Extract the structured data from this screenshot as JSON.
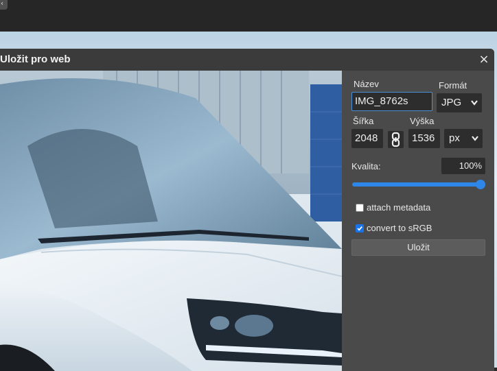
{
  "dialog": {
    "title": "Uložit pro web",
    "close_glyph": "×"
  },
  "panel": {
    "name_label": "Název",
    "name_value": "IMG_8762s",
    "format_label": "Formát",
    "format_value": "JPG",
    "width_label": "Šířka",
    "width_value": "2048",
    "height_label": "Výška",
    "height_value": "1536",
    "unit_value": "px",
    "quality_label": "Kvalita:",
    "quality_value": "100%",
    "quality_fraction": 1.0,
    "metadata_label": "attach metadata",
    "metadata_checked": false,
    "srgb_label": "convert to sRGB",
    "srgb_checked": true,
    "save_label": "Uložit"
  },
  "icons": {
    "close": "close-icon",
    "chain": "link-chain-icon",
    "chevron": "chevron-down-icon"
  },
  "colors": {
    "accent": "#2e86e8",
    "checkbox_checked": "#1a73e8",
    "dialog_bg": "#4a4a4a",
    "header_bg": "#3b3b3b",
    "input_bg": "#2d2d2d",
    "car_body": "#e6edf2"
  }
}
